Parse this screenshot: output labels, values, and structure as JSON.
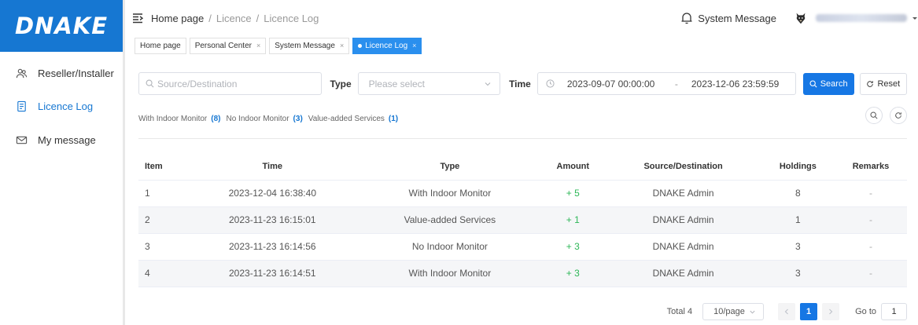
{
  "brand": {
    "logo_text": "DNAKE",
    "color": "#1677d2"
  },
  "sidebar": {
    "items": [
      {
        "label": "Reseller/Installer",
        "icon": "people-icon",
        "active": false
      },
      {
        "label": "Licence Log",
        "icon": "document-icon",
        "active": true
      },
      {
        "label": "My message",
        "icon": "envelope-icon",
        "active": false
      }
    ]
  },
  "header": {
    "breadcrumb": [
      "Home page",
      "/",
      "Licence",
      "/",
      "Licence Log"
    ],
    "system_message": "System Message"
  },
  "tabs": [
    {
      "label": "Home page",
      "closable": false,
      "active": false
    },
    {
      "label": "Personal Center",
      "closable": true,
      "active": false
    },
    {
      "label": "System Message",
      "closable": true,
      "active": false
    },
    {
      "label": "Licence Log",
      "closable": true,
      "active": true
    }
  ],
  "filters": {
    "search_placeholder": "Source/Destination",
    "type_label": "Type",
    "type_placeholder": "Please select",
    "time_label": "Time",
    "time_start": "2023-09-07 00:00:00",
    "time_sep": "-",
    "time_end": "2023-12-06 23:59:59",
    "search_button": "Search",
    "reset_button": "Reset"
  },
  "summary": [
    {
      "label": "With Indoor Monitor",
      "count": "(8)"
    },
    {
      "label": "No Indoor Monitor",
      "count": "(3)"
    },
    {
      "label": "Value-added Services",
      "count": "(1)"
    }
  ],
  "table": {
    "columns": [
      "Item",
      "Time",
      "Type",
      "Amount",
      "Source/Destination",
      "Holdings",
      "Remarks"
    ],
    "rows": [
      [
        "1",
        "2023-12-04 16:38:40",
        "With Indoor Monitor",
        "+ 5",
        "DNAKE Admin",
        "8",
        "-"
      ],
      [
        "2",
        "2023-11-23 16:15:01",
        "Value-added Services",
        "+ 1",
        "DNAKE Admin",
        "1",
        "-"
      ],
      [
        "3",
        "2023-11-23 16:14:56",
        "No Indoor Monitor",
        "+ 3",
        "DNAKE Admin",
        "3",
        "-"
      ],
      [
        "4",
        "2023-11-23 16:14:51",
        "With Indoor Monitor",
        "+ 3",
        "DNAKE Admin",
        "3",
        "-"
      ]
    ]
  },
  "pagination": {
    "total": "Total 4",
    "page_size": "10/page",
    "current_page": "1",
    "goto_label": "Go to",
    "goto_value": "1"
  }
}
